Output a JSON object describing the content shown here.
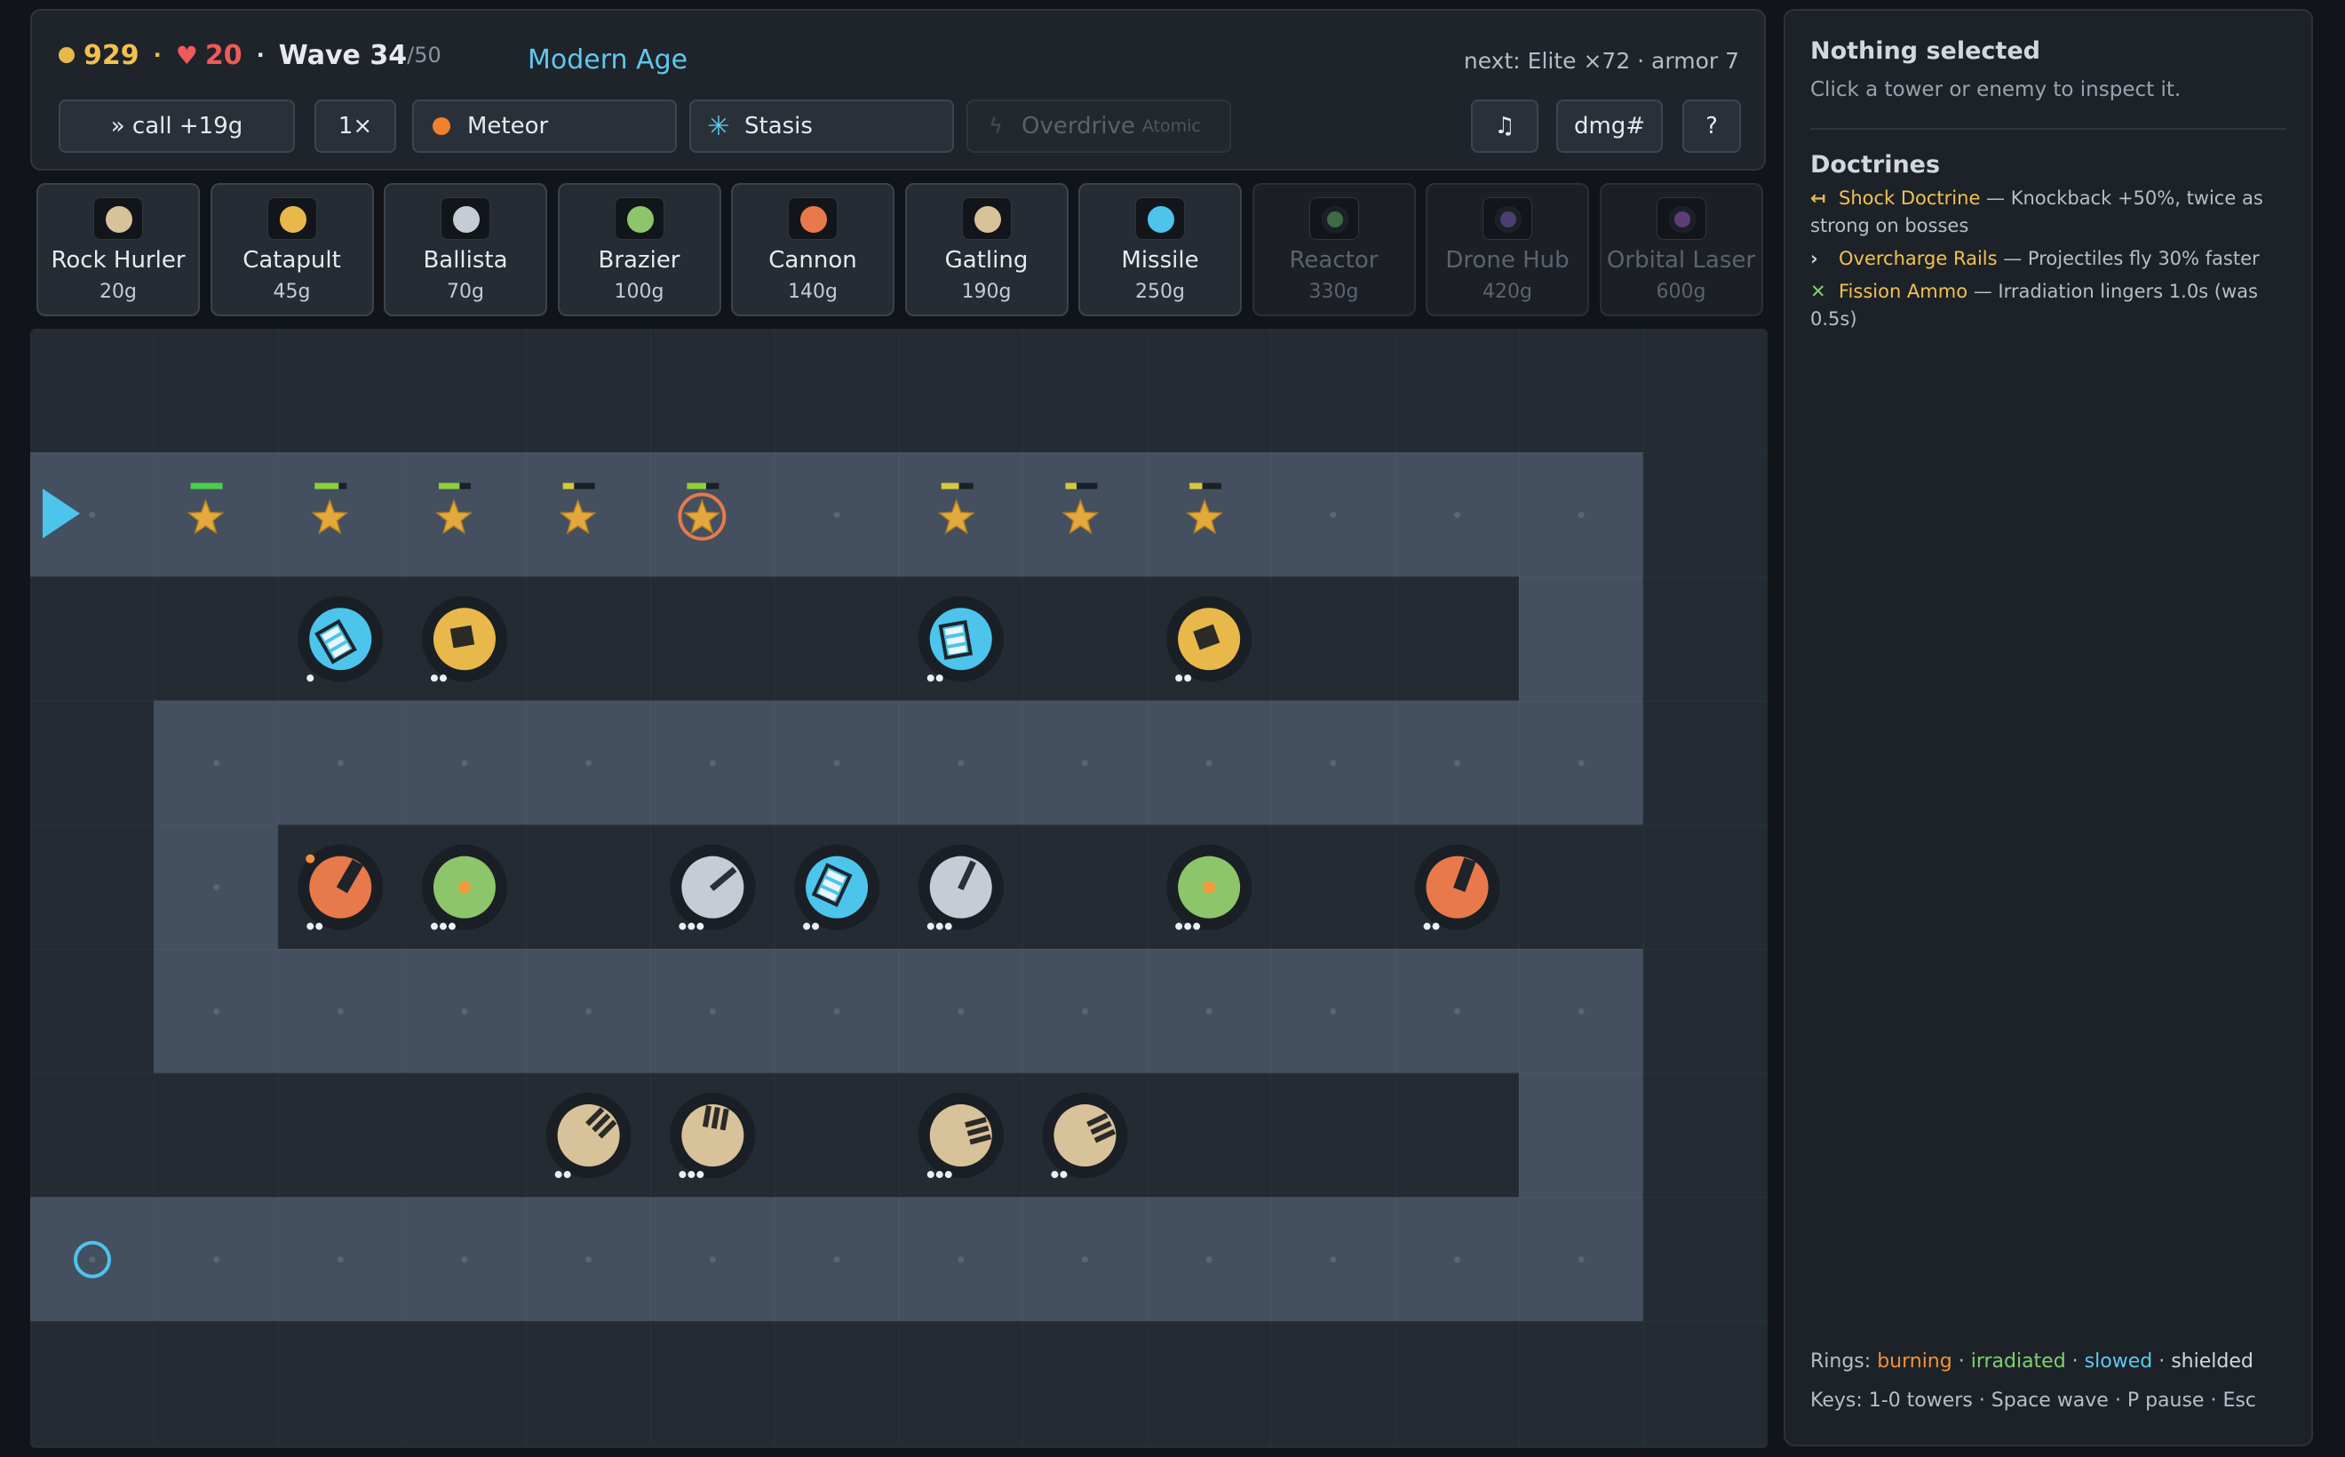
{
  "stats": {
    "gold": "929",
    "lives": "20",
    "wave_label": "Wave 34",
    "wave_max": "/50",
    "era": "Modern Age",
    "next": "next: Elite ×72 · armor 7"
  },
  "controls": {
    "call": "» call +19g",
    "speed": "1×",
    "meteor": "Meteor",
    "stasis": "Stasis",
    "overdrive": "Overdrive",
    "overdrive_sub": "Atomic",
    "music": "♫",
    "dmg": "dmg#",
    "help": "?"
  },
  "shop": [
    {
      "name": "Rock Hurler",
      "cost": "20g",
      "color": "#d8c29a",
      "locked": false
    },
    {
      "name": "Catapult",
      "cost": "45g",
      "color": "#e8b84a",
      "locked": false
    },
    {
      "name": "Ballista",
      "cost": "70g",
      "color": "#c5ccd6",
      "locked": false
    },
    {
      "name": "Brazier",
      "cost": "100g",
      "color": "#8cc56a",
      "locked": false
    },
    {
      "name": "Cannon",
      "cost": "140g",
      "color": "#e8794a",
      "locked": false
    },
    {
      "name": "Gatling",
      "cost": "190g",
      "color": "#d8c29a",
      "locked": false
    },
    {
      "name": "Missile",
      "cost": "250g",
      "color": "#4cc4ec",
      "locked": false
    },
    {
      "name": "Reactor",
      "cost": "330g",
      "color": "#3f6a45",
      "locked": true
    },
    {
      "name": "Drone Hub",
      "cost": "420g",
      "color": "#4b3f70",
      "locked": true
    },
    {
      "name": "Orbital Laser",
      "cost": "600g",
      "color": "#5f3e77",
      "locked": true
    }
  ],
  "towers": [
    {
      "type": "missile",
      "color": "#4cc4ec",
      "col": 2,
      "row": 2,
      "level": 1,
      "angle": -30
    },
    {
      "type": "catapult",
      "color": "#e8b84a",
      "col": 3,
      "row": 2,
      "level": 2,
      "angle": -10
    },
    {
      "type": "missile",
      "color": "#4cc4ec",
      "col": 7,
      "row": 2,
      "level": 2,
      "angle": -10
    },
    {
      "type": "catapult",
      "color": "#e8b84a",
      "col": 9,
      "row": 2,
      "level": 2,
      "angle": -20
    },
    {
      "type": "cannon",
      "color": "#e8794a",
      "col": 2,
      "row": 4,
      "level": 2,
      "angle": 30,
      "burning": true
    },
    {
      "type": "brazier",
      "color": "#8cc56a",
      "col": 3,
      "row": 4,
      "level": 3,
      "angle": 0
    },
    {
      "type": "ballista",
      "color": "#c5ccd6",
      "col": 5,
      "row": 4,
      "level": 3,
      "angle": 50
    },
    {
      "type": "missile",
      "color": "#4cc4ec",
      "col": 6,
      "row": 4,
      "level": 2,
      "angle": 25
    },
    {
      "type": "ballista",
      "color": "#c5ccd6",
      "col": 7,
      "row": 4,
      "level": 3,
      "angle": 25
    },
    {
      "type": "brazier",
      "color": "#8cc56a",
      "col": 9,
      "row": 4,
      "level": 3,
      "angle": 0
    },
    {
      "type": "cannon",
      "color": "#e8794a",
      "col": 11,
      "row": 4,
      "level": 2,
      "angle": 20
    },
    {
      "type": "gatling",
      "color": "#d8c29a",
      "col": 4,
      "row": 6,
      "level": 2,
      "angle": 45
    },
    {
      "type": "gatling",
      "color": "#d8c29a",
      "col": 5,
      "row": 6,
      "level": 3,
      "angle": 10
    },
    {
      "type": "gatling",
      "color": "#d8c29a",
      "col": 7,
      "row": 6,
      "level": 3,
      "angle": 75
    },
    {
      "type": "gatling",
      "color": "#d8c29a",
      "col": 8,
      "row": 6,
      "level": 2,
      "angle": 65
    }
  ],
  "enemies": [
    {
      "x": 1.0,
      "hp": 1.0,
      "boss": false
    },
    {
      "x": 2.0,
      "hp": 0.75,
      "boss": false
    },
    {
      "x": 3.0,
      "hp": 0.65,
      "boss": false
    },
    {
      "x": 4.0,
      "hp": 0.35,
      "boss": false
    },
    {
      "x": 5.0,
      "hp": 0.6,
      "boss": true
    },
    {
      "x": 7.05,
      "hp": 0.55,
      "boss": false
    },
    {
      "x": 8.05,
      "hp": 0.35,
      "boss": false
    },
    {
      "x": 9.05,
      "hp": 0.4,
      "boss": false
    }
  ],
  "panel": {
    "title": "Nothing selected",
    "hint": "Click a tower or enemy to inspect it.",
    "doctrines_title": "Doctrines",
    "doctrines": [
      {
        "icon": "↤",
        "icon_color": "#e8b84a",
        "name": "Shock Doctrine",
        "desc": " — Knockback +50%, twice as strong on bosses"
      },
      {
        "icon": "›",
        "icon_color": "#c8cdd4",
        "name": "Overcharge Rails",
        "desc": " — Projectiles fly 30% faster"
      },
      {
        "icon": "✕",
        "icon_color": "#7ed36a",
        "name": "Fission Ammo",
        "desc": " — Irradiation lingers 1.0s (was 0.5s)"
      }
    ],
    "legend": {
      "prefix": "Rings: ",
      "burning": "burning",
      "irradiated": "irradiated",
      "slowed": "slowed",
      "shielded": "shielded",
      "sep": " · "
    },
    "keys": "Keys: 1-0 towers · Space wave · P pause · Esc"
  }
}
